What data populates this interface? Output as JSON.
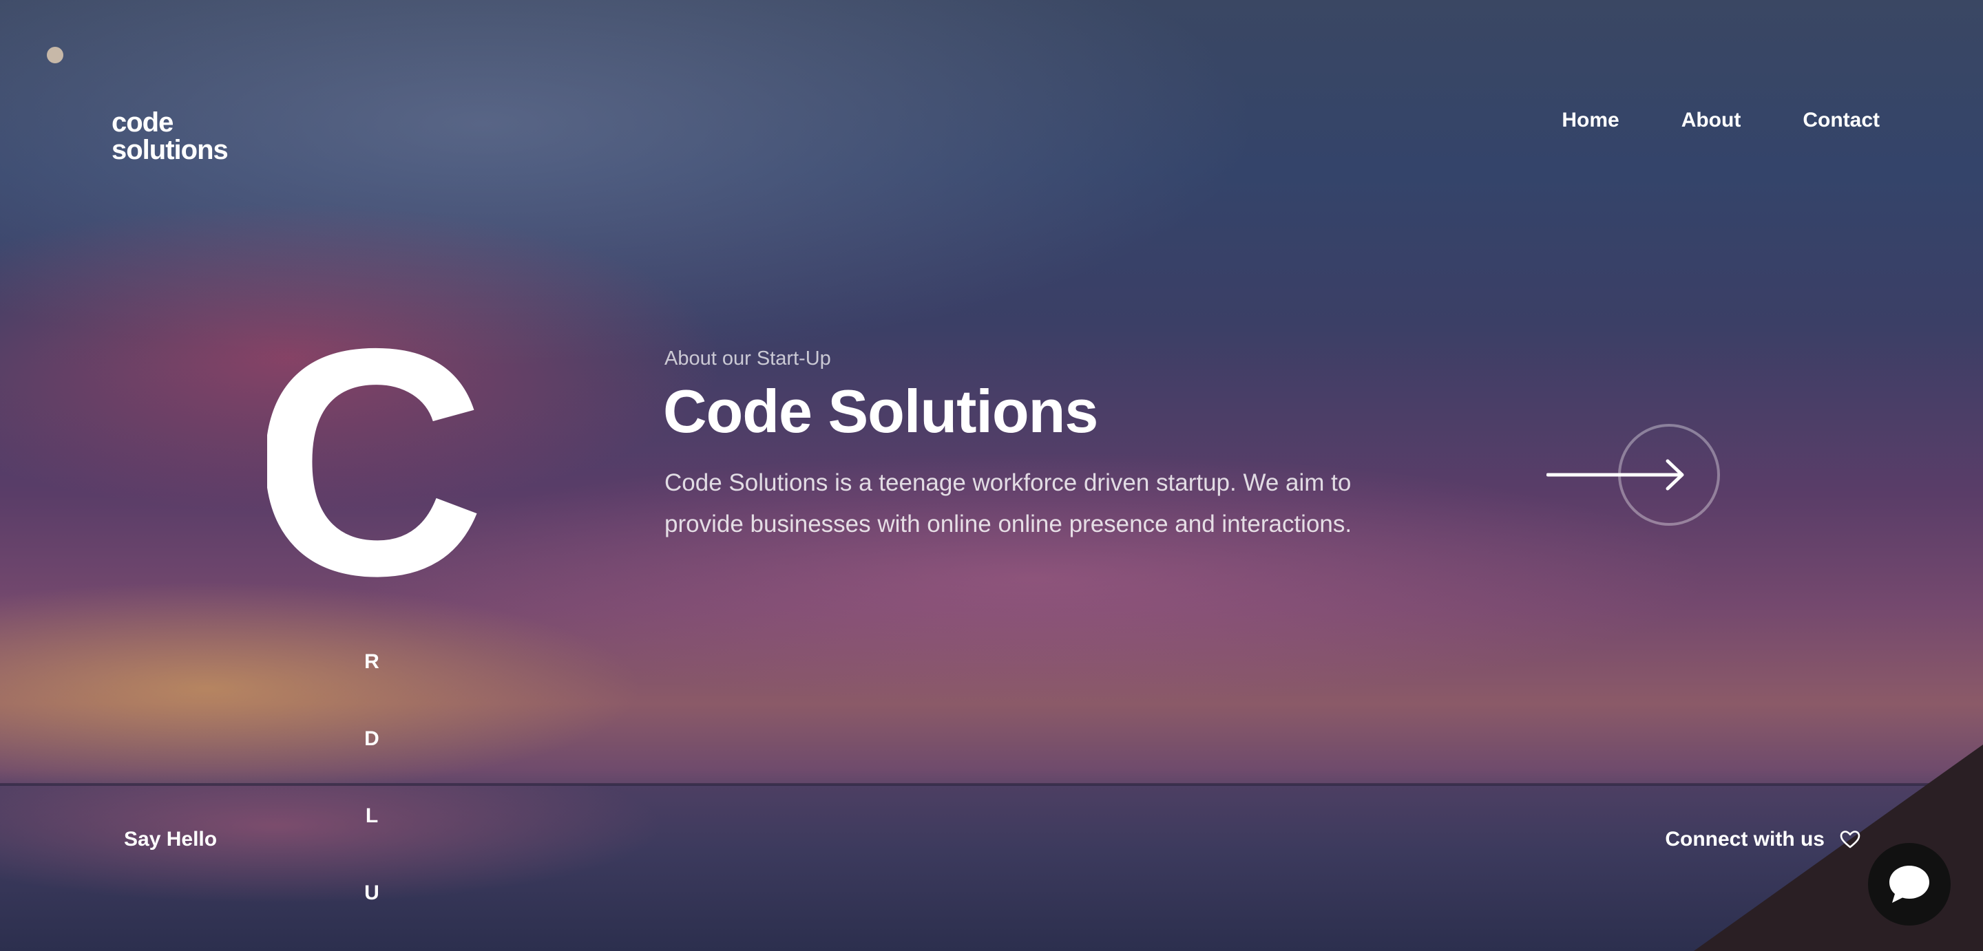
{
  "brand": {
    "line1": "code",
    "line2": "solutions"
  },
  "nav": {
    "items": [
      {
        "label": "Home"
      },
      {
        "label": "About"
      },
      {
        "label": "Contact"
      }
    ]
  },
  "hero": {
    "big_letter": "C",
    "eyebrow": "About our Start-Up",
    "title": "Code Solutions",
    "description": "Code Solutions is a teenage workforce driven startup. We aim to provide businesses with online online presence and interactions.",
    "vertical_letters": [
      "R",
      "D",
      "L",
      "U"
    ],
    "next_button_icon": "arrow-right-icon"
  },
  "footer": {
    "say_hello": "Say Hello",
    "connect": "Connect with us",
    "connect_icon": "heart-icon",
    "chat_icon": "chat-bubble-icon"
  },
  "colors": {
    "text": "#ffffff",
    "cursor_dot": "#c7b8a8",
    "chat_button": "#111111"
  }
}
